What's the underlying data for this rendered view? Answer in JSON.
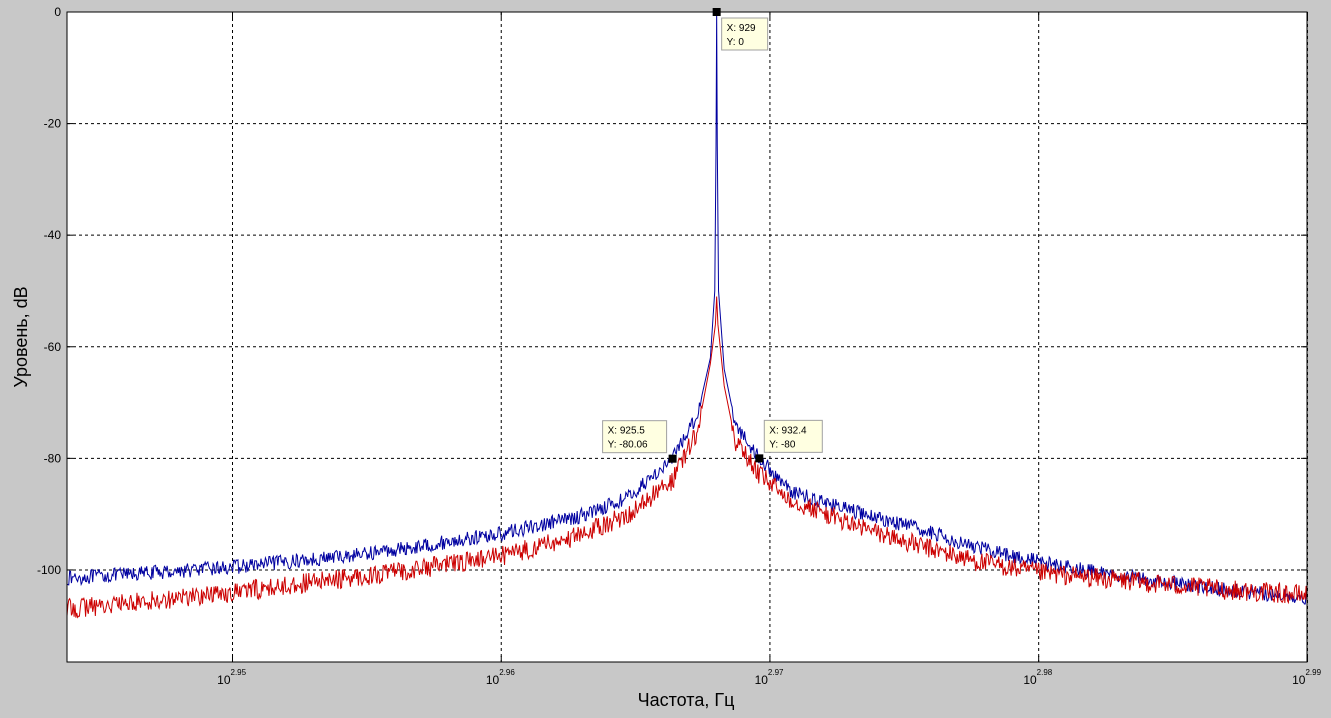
{
  "chart_data": {
    "type": "line",
    "title": "",
    "xlabel": "Частота, Гц",
    "ylabel": "Уровень, dB",
    "x_scale": "log",
    "xlim": [
      878.7,
      977.2
    ],
    "ylim": [
      -116.5,
      0
    ],
    "grid": true,
    "x_ticks": [
      {
        "base": "10",
        "exp": "2.95",
        "value": 891.25
      },
      {
        "base": "10",
        "exp": "2.96",
        "value": 912.01
      },
      {
        "base": "10",
        "exp": "2.97",
        "value": 933.25
      },
      {
        "base": "10",
        "exp": "2.98",
        "value": 954.99
      },
      {
        "base": "10",
        "exp": "2.99",
        "value": 977.24
      }
    ],
    "y_ticks": [
      0,
      -20,
      -40,
      -60,
      -80,
      -100
    ],
    "y_tick_labels": [
      "0",
      "-20",
      "-40",
      "-60",
      "-80",
      "-100"
    ],
    "series": [
      {
        "color": "#0000a0",
        "noise": 1.3,
        "x": [
          878.7,
          885,
          891.25,
          900,
          905,
          912,
          918,
          922,
          925.5,
          927.5,
          928.5,
          928.85,
          928.95,
          929.0,
          929.05,
          929.15,
          929.6,
          930.5,
          932.4,
          935,
          940,
          945,
          950,
          955,
          960,
          965,
          970,
          977.2
        ],
        "y": [
          -101.5,
          -100.5,
          -99.5,
          -97.5,
          -96.0,
          -93.5,
          -90.5,
          -87.0,
          -80.06,
          -72.0,
          -62.0,
          -50.0,
          -24.0,
          0,
          -24.0,
          -50.0,
          -64.0,
          -74.0,
          -80.0,
          -86.0,
          -89.5,
          -92.5,
          -96.0,
          -98.5,
          -100.5,
          -102.0,
          -103.5,
          -105.0
        ]
      },
      {
        "color": "#cc0000",
        "noise": 1.8,
        "x": [
          878.7,
          885,
          891.25,
          900,
          905,
          912,
          918,
          922,
          925.5,
          927.5,
          928.5,
          928.9,
          929.0,
          929.1,
          929.6,
          930.5,
          932.4,
          935,
          940,
          945,
          950,
          955,
          960,
          965,
          970,
          977.2
        ],
        "y": [
          -107.0,
          -105.5,
          -104.0,
          -101.5,
          -100.0,
          -97.5,
          -94.0,
          -90.0,
          -84.0,
          -75.0,
          -63.0,
          -56.0,
          -51.0,
          -56.0,
          -67.0,
          -77.0,
          -83.0,
          -87.5,
          -92.0,
          -95.5,
          -98.5,
          -100.5,
          -101.5,
          -102.5,
          -103.5,
          -104.5
        ]
      }
    ],
    "datatips": [
      {
        "x": 929,
        "y": 0,
        "label_x": "X: 929",
        "label_y": "Y: 0",
        "anchor": "right"
      },
      {
        "x": 925.5,
        "y": -80.06,
        "label_x": "X: 925.5",
        "label_y": "Y: -80.06",
        "anchor": "left"
      },
      {
        "x": 932.4,
        "y": -80,
        "label_x": "X: 932.4",
        "label_y": "Y: -80",
        "anchor": "right"
      }
    ]
  }
}
